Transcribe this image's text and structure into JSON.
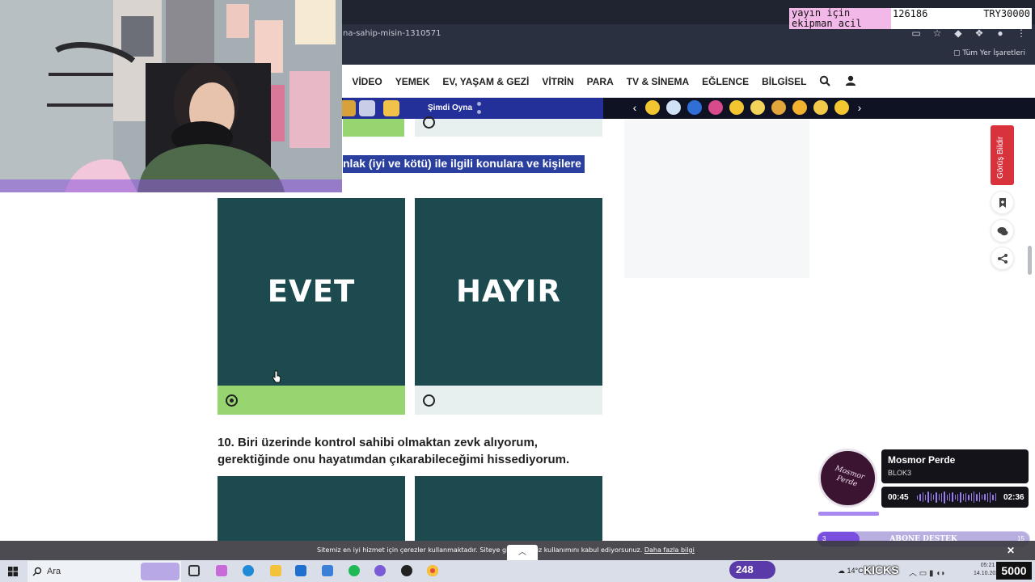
{
  "browser": {
    "url_fragment": "na-sahip-misin-1310571",
    "bookmarks_label": "Tüm Yer İşaretleri"
  },
  "donation": {
    "message": "yayın için ekipman acil",
    "id": "126186",
    "amount": "TRY30000"
  },
  "site": {
    "nav_partial": "I",
    "nav": [
      "VİDEO",
      "YEMEK",
      "EV, YAŞAM & GEZİ",
      "VİTRİN",
      "PARA",
      "TV & SİNEMA",
      "EĞLENCE",
      "BİLGİSEL"
    ],
    "play_now": "Şimdi Oyna"
  },
  "quiz": {
    "prev_question_fragment": "nlak (iyi ve kötü) ile ilgili konulara ve kişilere",
    "answer_yes": "EVET",
    "answer_no": "HAYIR",
    "selected": "EVET",
    "question_10": "10. Biri üzerinde kontrol sahibi olmaktan zevk alıyorum, gerektiğinde onu hayatımdan çıkarabileceğimi hissediyorum."
  },
  "sidebar": {
    "feedback_label": "Görüş Bildir"
  },
  "music": {
    "disc_text": "Mosmor Perde",
    "title": "Mosmor Perde",
    "artist": "BLOK3",
    "elapsed": "00:45",
    "duration": "02:36",
    "progress": 0.29
  },
  "subscribe": {
    "left": "3",
    "label": "ABONE DESTEK",
    "right": "15",
    "progress": 0.2
  },
  "cookie": {
    "text": "Sitemiz en iyi hizmet için çerezler kullanmaktadır. Siteye giriş y",
    "text2": "rez kullanımını kabul ediyorsunuz.",
    "link": "Daha fazla bilgi"
  },
  "taskbar": {
    "search_placeholder": "Ara",
    "viewers": "248",
    "weather": "14°C",
    "weather_suffix": "Ç",
    "kicks_label": "KICKS",
    "time": "05:21",
    "date": "14.10.2025",
    "kick_count": "5000"
  },
  "colors": {
    "card": "#1d4a4f",
    "selected_strip": "#97d571",
    "unselected_strip": "#e7f0ee",
    "highlight": "#2a3f9e",
    "feedback": "#d8323c"
  }
}
